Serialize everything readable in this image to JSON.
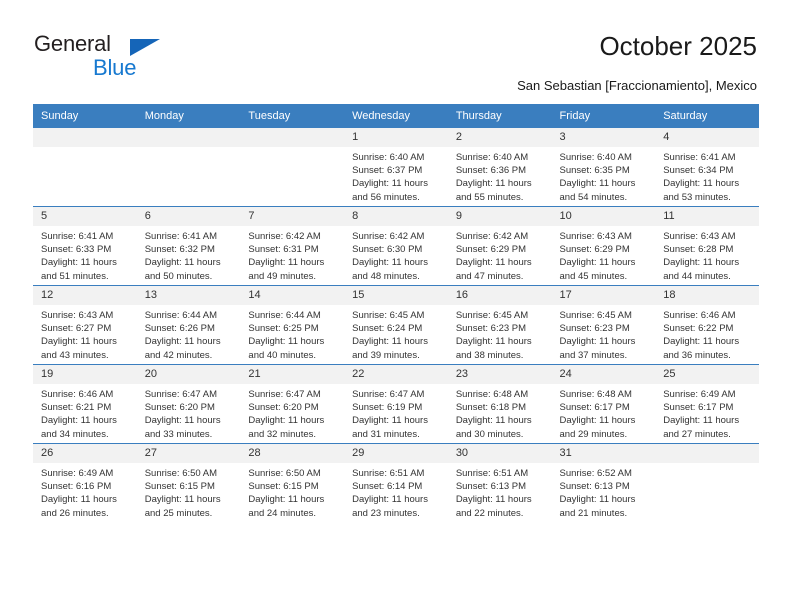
{
  "brand": {
    "name_dark": "General",
    "name_blue": "Blue",
    "color_dark": "#231f20",
    "color_blue": "#1779d0",
    "accent": "#3a7ebf"
  },
  "header": {
    "title": "October 2025",
    "subtitle": "San Sebastian [Fraccionamiento], Mexico"
  },
  "weekday_headers": [
    "Sunday",
    "Monday",
    "Tuesday",
    "Wednesday",
    "Thursday",
    "Friday",
    "Saturday"
  ],
  "weeks": [
    [
      {
        "day": "",
        "sunrise": "",
        "sunset": "",
        "daylight1": "",
        "daylight2": ""
      },
      {
        "day": "",
        "sunrise": "",
        "sunset": "",
        "daylight1": "",
        "daylight2": ""
      },
      {
        "day": "",
        "sunrise": "",
        "sunset": "",
        "daylight1": "",
        "daylight2": ""
      },
      {
        "day": "1",
        "sunrise": "Sunrise: 6:40 AM",
        "sunset": "Sunset: 6:37 PM",
        "daylight1": "Daylight: 11 hours",
        "daylight2": "and 56 minutes."
      },
      {
        "day": "2",
        "sunrise": "Sunrise: 6:40 AM",
        "sunset": "Sunset: 6:36 PM",
        "daylight1": "Daylight: 11 hours",
        "daylight2": "and 55 minutes."
      },
      {
        "day": "3",
        "sunrise": "Sunrise: 6:40 AM",
        "sunset": "Sunset: 6:35 PM",
        "daylight1": "Daylight: 11 hours",
        "daylight2": "and 54 minutes."
      },
      {
        "day": "4",
        "sunrise": "Sunrise: 6:41 AM",
        "sunset": "Sunset: 6:34 PM",
        "daylight1": "Daylight: 11 hours",
        "daylight2": "and 53 minutes."
      }
    ],
    [
      {
        "day": "5",
        "sunrise": "Sunrise: 6:41 AM",
        "sunset": "Sunset: 6:33 PM",
        "daylight1": "Daylight: 11 hours",
        "daylight2": "and 51 minutes."
      },
      {
        "day": "6",
        "sunrise": "Sunrise: 6:41 AM",
        "sunset": "Sunset: 6:32 PM",
        "daylight1": "Daylight: 11 hours",
        "daylight2": "and 50 minutes."
      },
      {
        "day": "7",
        "sunrise": "Sunrise: 6:42 AM",
        "sunset": "Sunset: 6:31 PM",
        "daylight1": "Daylight: 11 hours",
        "daylight2": "and 49 minutes."
      },
      {
        "day": "8",
        "sunrise": "Sunrise: 6:42 AM",
        "sunset": "Sunset: 6:30 PM",
        "daylight1": "Daylight: 11 hours",
        "daylight2": "and 48 minutes."
      },
      {
        "day": "9",
        "sunrise": "Sunrise: 6:42 AM",
        "sunset": "Sunset: 6:29 PM",
        "daylight1": "Daylight: 11 hours",
        "daylight2": "and 47 minutes."
      },
      {
        "day": "10",
        "sunrise": "Sunrise: 6:43 AM",
        "sunset": "Sunset: 6:29 PM",
        "daylight1": "Daylight: 11 hours",
        "daylight2": "and 45 minutes."
      },
      {
        "day": "11",
        "sunrise": "Sunrise: 6:43 AM",
        "sunset": "Sunset: 6:28 PM",
        "daylight1": "Daylight: 11 hours",
        "daylight2": "and 44 minutes."
      }
    ],
    [
      {
        "day": "12",
        "sunrise": "Sunrise: 6:43 AM",
        "sunset": "Sunset: 6:27 PM",
        "daylight1": "Daylight: 11 hours",
        "daylight2": "and 43 minutes."
      },
      {
        "day": "13",
        "sunrise": "Sunrise: 6:44 AM",
        "sunset": "Sunset: 6:26 PM",
        "daylight1": "Daylight: 11 hours",
        "daylight2": "and 42 minutes."
      },
      {
        "day": "14",
        "sunrise": "Sunrise: 6:44 AM",
        "sunset": "Sunset: 6:25 PM",
        "daylight1": "Daylight: 11 hours",
        "daylight2": "and 40 minutes."
      },
      {
        "day": "15",
        "sunrise": "Sunrise: 6:45 AM",
        "sunset": "Sunset: 6:24 PM",
        "daylight1": "Daylight: 11 hours",
        "daylight2": "and 39 minutes."
      },
      {
        "day": "16",
        "sunrise": "Sunrise: 6:45 AM",
        "sunset": "Sunset: 6:23 PM",
        "daylight1": "Daylight: 11 hours",
        "daylight2": "and 38 minutes."
      },
      {
        "day": "17",
        "sunrise": "Sunrise: 6:45 AM",
        "sunset": "Sunset: 6:23 PM",
        "daylight1": "Daylight: 11 hours",
        "daylight2": "and 37 minutes."
      },
      {
        "day": "18",
        "sunrise": "Sunrise: 6:46 AM",
        "sunset": "Sunset: 6:22 PM",
        "daylight1": "Daylight: 11 hours",
        "daylight2": "and 36 minutes."
      }
    ],
    [
      {
        "day": "19",
        "sunrise": "Sunrise: 6:46 AM",
        "sunset": "Sunset: 6:21 PM",
        "daylight1": "Daylight: 11 hours",
        "daylight2": "and 34 minutes."
      },
      {
        "day": "20",
        "sunrise": "Sunrise: 6:47 AM",
        "sunset": "Sunset: 6:20 PM",
        "daylight1": "Daylight: 11 hours",
        "daylight2": "and 33 minutes."
      },
      {
        "day": "21",
        "sunrise": "Sunrise: 6:47 AM",
        "sunset": "Sunset: 6:20 PM",
        "daylight1": "Daylight: 11 hours",
        "daylight2": "and 32 minutes."
      },
      {
        "day": "22",
        "sunrise": "Sunrise: 6:47 AM",
        "sunset": "Sunset: 6:19 PM",
        "daylight1": "Daylight: 11 hours",
        "daylight2": "and 31 minutes."
      },
      {
        "day": "23",
        "sunrise": "Sunrise: 6:48 AM",
        "sunset": "Sunset: 6:18 PM",
        "daylight1": "Daylight: 11 hours",
        "daylight2": "and 30 minutes."
      },
      {
        "day": "24",
        "sunrise": "Sunrise: 6:48 AM",
        "sunset": "Sunset: 6:17 PM",
        "daylight1": "Daylight: 11 hours",
        "daylight2": "and 29 minutes."
      },
      {
        "day": "25",
        "sunrise": "Sunrise: 6:49 AM",
        "sunset": "Sunset: 6:17 PM",
        "daylight1": "Daylight: 11 hours",
        "daylight2": "and 27 minutes."
      }
    ],
    [
      {
        "day": "26",
        "sunrise": "Sunrise: 6:49 AM",
        "sunset": "Sunset: 6:16 PM",
        "daylight1": "Daylight: 11 hours",
        "daylight2": "and 26 minutes."
      },
      {
        "day": "27",
        "sunrise": "Sunrise: 6:50 AM",
        "sunset": "Sunset: 6:15 PM",
        "daylight1": "Daylight: 11 hours",
        "daylight2": "and 25 minutes."
      },
      {
        "day": "28",
        "sunrise": "Sunrise: 6:50 AM",
        "sunset": "Sunset: 6:15 PM",
        "daylight1": "Daylight: 11 hours",
        "daylight2": "and 24 minutes."
      },
      {
        "day": "29",
        "sunrise": "Sunrise: 6:51 AM",
        "sunset": "Sunset: 6:14 PM",
        "daylight1": "Daylight: 11 hours",
        "daylight2": "and 23 minutes."
      },
      {
        "day": "30",
        "sunrise": "Sunrise: 6:51 AM",
        "sunset": "Sunset: 6:13 PM",
        "daylight1": "Daylight: 11 hours",
        "daylight2": "and 22 minutes."
      },
      {
        "day": "31",
        "sunrise": "Sunrise: 6:52 AM",
        "sunset": "Sunset: 6:13 PM",
        "daylight1": "Daylight: 11 hours",
        "daylight2": "and 21 minutes."
      },
      {
        "day": "",
        "sunrise": "",
        "sunset": "",
        "daylight1": "",
        "daylight2": ""
      }
    ]
  ]
}
